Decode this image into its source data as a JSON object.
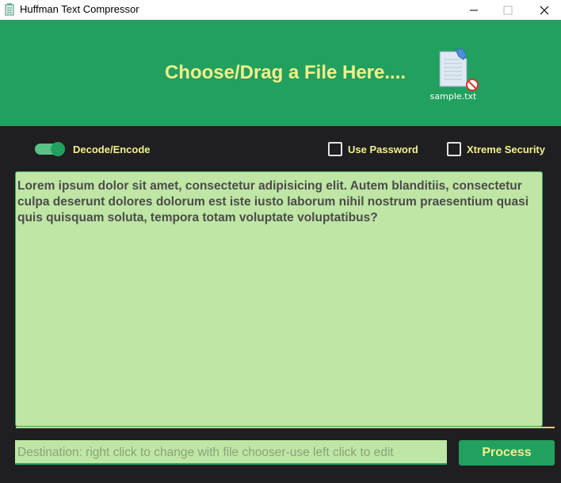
{
  "window": {
    "title": "Huffman Text Compressor",
    "app_icon": "notepad-icon",
    "controls": [
      "minimize-icon",
      "maximize-icon",
      "close-icon"
    ]
  },
  "header": {
    "prompt": "Choose/Drag a File Here....",
    "file": {
      "name": "sample.txt",
      "icon": "text-file-icon",
      "badge": "no-entry-icon"
    }
  },
  "options": {
    "decode_encode": {
      "label": "Decode/Encode",
      "on": true
    },
    "use_password": {
      "label": "Use Password",
      "checked": false
    },
    "xtreme_security": {
      "label": "Xtreme Security",
      "checked": false
    }
  },
  "editor": {
    "text": "Lorem ipsum dolor sit amet, consectetur adipisicing elit. Autem blanditiis, consectetur culpa deserunt dolores dolorum est iste iusto laborum nihil nostrum praesentium quasi quis quisquam soluta, tempora totam voluptate voluptatibus?"
  },
  "destination": {
    "placeholder": "Destination: right click to change with file chooser-use left click to edit"
  },
  "actions": {
    "process_label": "Process"
  },
  "colors": {
    "header_bg": "#22a05f",
    "accent_text": "#f2ef8a",
    "body_bg": "#1f1f21",
    "editor_bg": "#bfe6a4"
  }
}
